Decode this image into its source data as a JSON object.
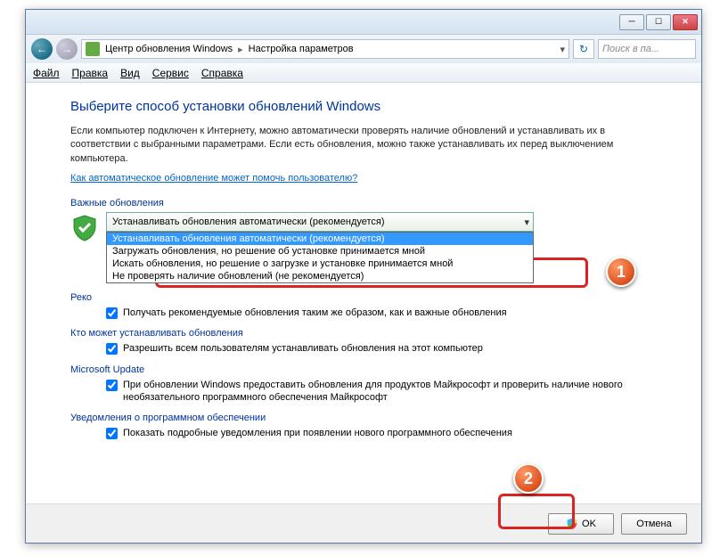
{
  "breadcrumb": {
    "item1": "Центр обновления Windows",
    "item2": "Настройка параметров"
  },
  "search": {
    "placeholder": "Поиск в па..."
  },
  "menubar": {
    "file": "Файл",
    "edit": "Правка",
    "view": "Вид",
    "tools": "Сервис",
    "help": "Справка"
  },
  "heading": "Выберите способ установки обновлений Windows",
  "intro": "Если компьютер подключен к Интернету, можно автоматически проверять наличие обновлений и устанавливать их в соответствии с выбранными параметрами. Если есть обновления, можно также устанавливать их перед выключением компьютера.",
  "help_link": "Как автоматическое обновление может помочь пользователю?",
  "sections": {
    "important": "Важные обновления",
    "recommended_prefix": "Реко",
    "who": "Кто может устанавливать обновления",
    "msupdate": "Microsoft Update",
    "software_notify": "Уведомления о программном обеспечении"
  },
  "dropdown": {
    "selected": "Устанавливать обновления автоматически (рекомендуется)",
    "options": [
      "Устанавливать обновления автоматически (рекомендуется)",
      "Загружать обновления, но решение об установке принимается мной",
      "Искать обновления, но решение о загрузке и установке принимается мной",
      "Не проверять наличие обновлений (не рекомендуется)"
    ]
  },
  "checkboxes": {
    "recommended": "Получать рекомендуемые обновления таким же образом, как и важные обновления",
    "allow_users": "Разрешить всем пользователям устанавливать обновления на этот компьютер",
    "ms_products": "При обновлении Windows предоставить обновления для продуктов Майкрософт и проверить наличие нового необязательного программного обеспечения Майкрософт",
    "software_notify_partial": "Показать подробные уведомления при появлении нового программного обеспечения"
  },
  "buttons": {
    "ok": "OK",
    "cancel": "Отмена"
  },
  "callouts": {
    "one": "1",
    "two": "2"
  }
}
